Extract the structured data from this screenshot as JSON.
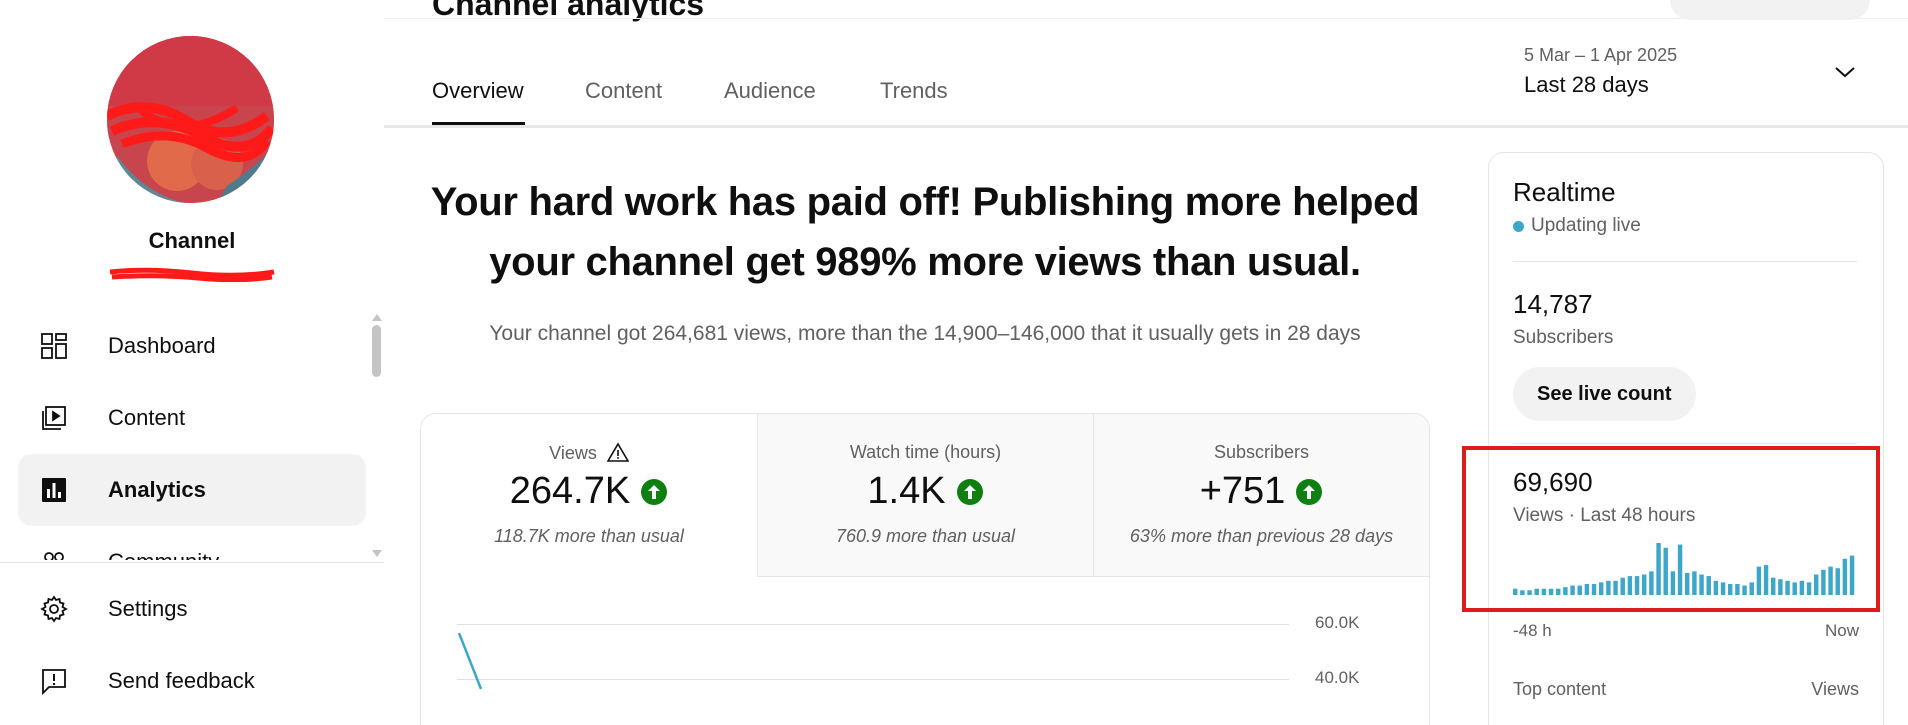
{
  "page": {
    "title": "Channel analytics"
  },
  "sidebar": {
    "channel_name": "Channel",
    "nav": [
      {
        "label": "Dashboard",
        "icon": "dashboard-icon"
      },
      {
        "label": "Content",
        "icon": "content-icon"
      },
      {
        "label": "Analytics",
        "icon": "analytics-icon",
        "active": true
      },
      {
        "label": "Community",
        "icon": "community-icon"
      }
    ],
    "bottom": [
      {
        "label": "Settings",
        "icon": "gear-icon"
      },
      {
        "label": "Send feedback",
        "icon": "feedback-icon"
      }
    ]
  },
  "tabs": [
    {
      "label": "Overview",
      "active": true
    },
    {
      "label": "Content"
    },
    {
      "label": "Audience"
    },
    {
      "label": "Trends"
    }
  ],
  "date_picker": {
    "range": "5 Mar – 1 Apr 2025",
    "label": "Last 28 days"
  },
  "summary": {
    "headline": "Your hard work has paid off! Publishing more helped your channel get 989% more views than usual.",
    "detail": "Your channel got 264,681 views, more than the 14,900–146,000 that it usually gets in 28 days"
  },
  "metrics": [
    {
      "title": "Views",
      "value": "264.7K",
      "note": "118.7K more than usual"
    },
    {
      "title": "Watch time (hours)",
      "value": "1.4K",
      "note": "760.9 more than usual"
    },
    {
      "title": "Subscribers",
      "value": "+751",
      "note": "63% more than previous 28 days"
    }
  ],
  "views_chart": {
    "y_ticks": [
      "60.0K",
      "40.0K"
    ]
  },
  "realtime": {
    "title": "Realtime",
    "live_text": "Updating live",
    "subscribers_value": "14,787",
    "subscribers_label": "Subscribers",
    "live_count_button": "See live count",
    "views_value": "69,690",
    "views_label": "Views · Last 48 hours",
    "axis_start": "-48 h",
    "axis_end": "Now",
    "top_content_label": "Top content",
    "top_content_metric": "Views"
  },
  "chart_data": {
    "type": "bar",
    "x": [
      -48,
      -47,
      -46,
      -45,
      -44,
      -43,
      -42,
      -41,
      -40,
      -39,
      -38,
      -37,
      -36,
      -35,
      -34,
      -33,
      -32,
      -31,
      -30,
      -29,
      -28,
      -27,
      -26,
      -25,
      -24,
      -23,
      -22,
      -21,
      -20,
      -19,
      -18,
      -17,
      -16,
      -15,
      -14,
      -13,
      -12,
      -11,
      -10,
      -9,
      -8,
      -7,
      -6,
      -5,
      -4,
      -3,
      -2,
      -1
    ],
    "values": [
      4,
      3,
      3,
      4,
      4,
      4,
      4,
      5,
      6,
      6,
      7,
      7,
      8,
      9,
      9,
      11,
      12,
      12,
      13,
      15,
      33,
      30,
      15,
      32,
      14,
      15,
      13,
      12,
      9,
      8,
      7,
      7,
      6,
      8,
      18,
      19,
      11,
      10,
      9,
      8,
      9,
      8,
      13,
      16,
      18,
      17,
      23,
      25
    ],
    "xlabel_start": "-48 h",
    "xlabel_end": "Now",
    "total": "69,690",
    "color": "#3ea6c8"
  }
}
